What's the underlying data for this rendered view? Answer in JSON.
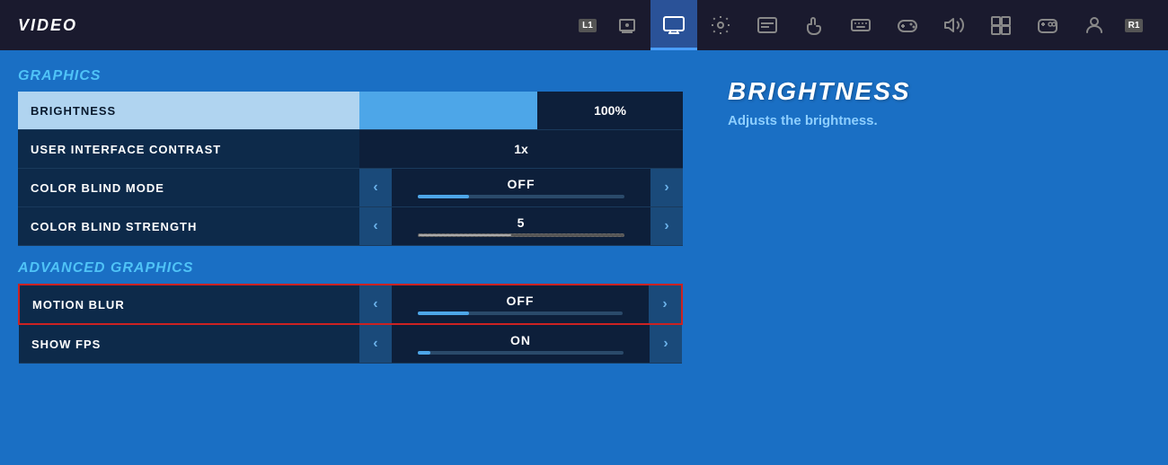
{
  "topNav": {
    "title": "VIDEO",
    "badge_l": "L1",
    "badge_r": "R1",
    "icons": [
      {
        "name": "notifications-icon",
        "symbol": "🔔",
        "active": false
      },
      {
        "name": "display-icon",
        "symbol": "🖥",
        "active": true
      },
      {
        "name": "settings-icon",
        "symbol": "⚙",
        "active": false
      },
      {
        "name": "subtitles-icon",
        "symbol": "⊟",
        "active": false
      },
      {
        "name": "touch-icon",
        "symbol": "☎",
        "active": false
      },
      {
        "name": "keyboard-icon",
        "symbol": "⌨",
        "active": false
      },
      {
        "name": "controller-icon",
        "symbol": "🎮",
        "active": false
      },
      {
        "name": "audio-icon",
        "symbol": "🔊",
        "active": false
      },
      {
        "name": "display2-icon",
        "symbol": "⊞",
        "active": false
      },
      {
        "name": "gamepad-icon",
        "symbol": "🕹",
        "active": false
      },
      {
        "name": "user-icon",
        "symbol": "👤",
        "active": false
      }
    ]
  },
  "sections": {
    "graphics": {
      "title": "GRAPHICS",
      "rows": [
        {
          "label": "BRIGHTNESS",
          "type": "slider",
          "value": "100%",
          "fillPercent": 55,
          "selected": true
        },
        {
          "label": "USER INTERFACE CONTRAST",
          "type": "plain",
          "value": "1x"
        },
        {
          "label": "COLOR BLIND MODE",
          "type": "arrow",
          "value": "OFF",
          "sliderType": "short"
        },
        {
          "label": "COLOR BLIND STRENGTH",
          "type": "arrow",
          "value": "5",
          "sliderType": "dashed"
        }
      ]
    },
    "advancedGraphics": {
      "title": "ADVANCED GRAPHICS",
      "rows": [
        {
          "label": "MOTION BLUR",
          "type": "arrow",
          "value": "OFF",
          "sliderType": "short",
          "highlighted": true
        },
        {
          "label": "SHOW FPS",
          "type": "arrow",
          "value": "ON",
          "sliderType": "single"
        }
      ]
    }
  },
  "infoPanel": {
    "title": "BRIGHTNESS",
    "description": "Adjusts the brightness."
  }
}
